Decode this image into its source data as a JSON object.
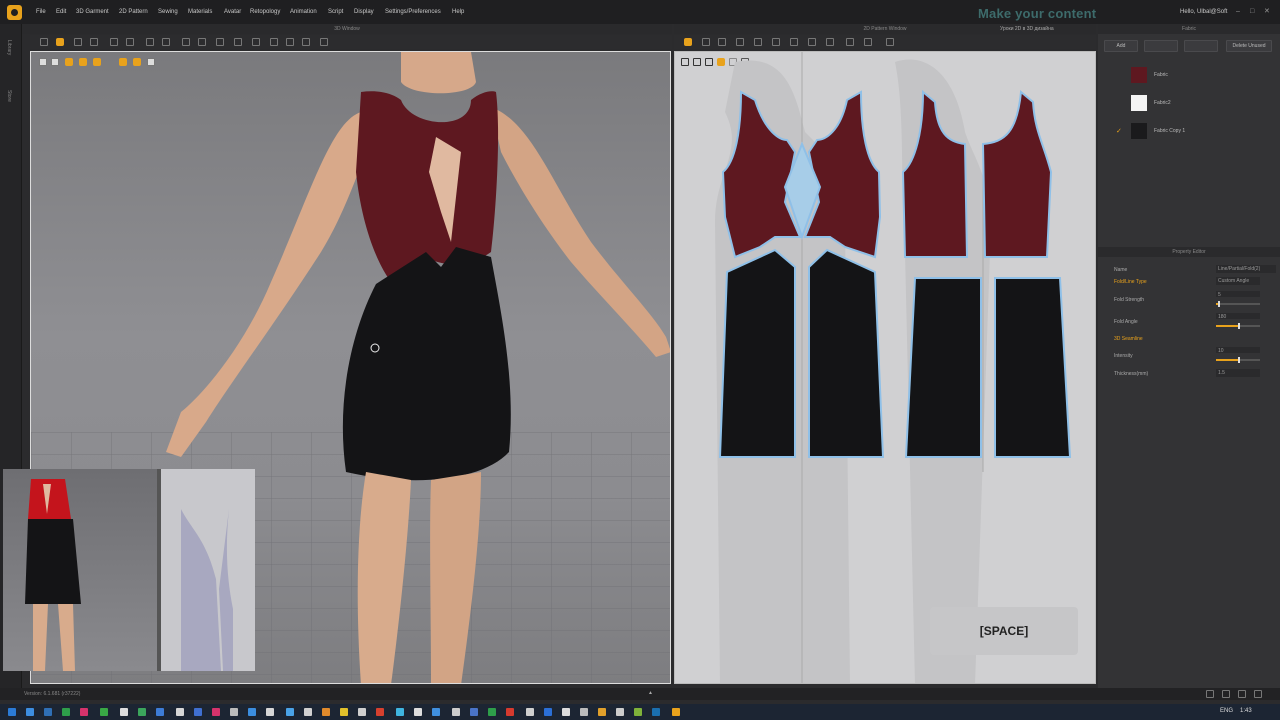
{
  "menubar": {
    "items": [
      "File",
      "Edit",
      "3D Garment",
      "2D Pattern",
      "Sewing",
      "Materials",
      "Avatar",
      "Retopology",
      "Animation",
      "Script",
      "Display",
      "Settings/Preferences",
      "Help"
    ],
    "banner": "Make your content",
    "greeting": "Hello, Ulbal@Soft"
  },
  "left_tabs": [
    "Library",
    "Store"
  ],
  "viewport3d": {
    "title": "3D Window"
  },
  "viewport2d": {
    "title": "2D Pattern Window",
    "subtitle": "Уроки 2D в 3D дизайна",
    "overlay": "[SPACE]"
  },
  "fabric_panel": {
    "title": "Fabric",
    "buttons": [
      "Add",
      "Delete Unused"
    ],
    "fabrics": [
      {
        "name": "Fabric",
        "color": "#5e1820",
        "selected": false
      },
      {
        "name": "Fabric2",
        "color": "#f4f4f4",
        "selected": false
      },
      {
        "name": "Fabric Copy 1",
        "color": "#1a1a1c",
        "selected": true
      }
    ]
  },
  "property_panel": {
    "title": "Property Editor",
    "rows": [
      {
        "label": "Name",
        "value": "Line/Partial/Fold(2)",
        "type": "text"
      },
      {
        "label": "Fold/Line Type",
        "value": "Custom Angle",
        "type": "select",
        "accent": true
      },
      {
        "label": "Fold Strength",
        "value": "5",
        "type": "slider",
        "level": 0.05
      },
      {
        "label": "Fold Angle",
        "value": "180",
        "type": "slider",
        "level": 0.5
      },
      {
        "label": "3D Seamline",
        "value": "",
        "type": "section",
        "accent": true
      },
      {
        "label": "Intensity",
        "value": "10",
        "type": "slider",
        "level": 0.5
      },
      {
        "label": "Thickness(mm)",
        "value": "1.5",
        "type": "text"
      }
    ]
  },
  "status": {
    "version": "Version: 6.1.681 (r37222)"
  },
  "taskbar": {
    "lang": "ENG",
    "time": "1:43"
  },
  "colors": {
    "accent": "#e8a21c",
    "wine": "#5e1820",
    "black": "#141416",
    "seam": "#8fc0e8"
  }
}
